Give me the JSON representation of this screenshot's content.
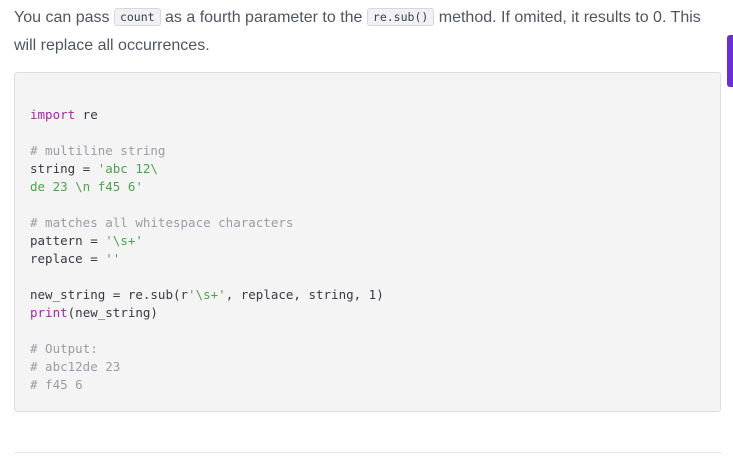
{
  "intro": {
    "part1": "You can pass ",
    "code1": "count",
    "part2": " as a fourth parameter to the ",
    "code2": "re.sub()",
    "part3": " method. If omited, it results to 0. This will replace all occurrences."
  },
  "code": {
    "l01_kw": "import",
    "l01_rest": " re",
    "l02": "",
    "l03": "# multiline string",
    "l04_a": "string = ",
    "l04_s": "'abc 12\\",
    "l05_s": "de 23 \\n f45 6'",
    "l06": "",
    "l07": "# matches all whitespace characters",
    "l08_a": "pattern = ",
    "l08_s": "'\\s+'",
    "l09_a": "replace = ",
    "l09_s": "''",
    "l10": "",
    "l11_a": "new_string = re.sub(r",
    "l11_s": "'\\s+'",
    "l11_b": ", replace, string, 1)",
    "l12_fn": "print",
    "l12_rest": "(new_string)",
    "l13": "",
    "l14": "# Output:",
    "l15": "# abc12de 23",
    "l16": "# f45 6"
  },
  "colors": {
    "accent": "#6b2dd8",
    "keyword": "#a626a4",
    "string": "#50a14f",
    "comment": "#9a9da3"
  }
}
